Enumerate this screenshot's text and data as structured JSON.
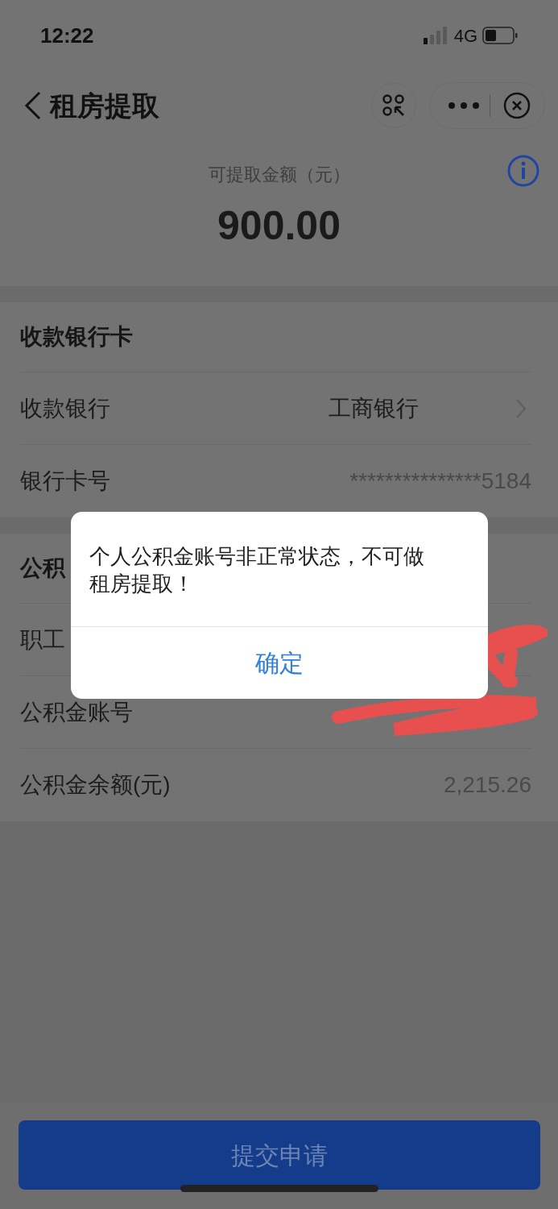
{
  "status_bar": {
    "time": "12:22",
    "network": "4G"
  },
  "nav": {
    "title": "租房提取"
  },
  "amount": {
    "label": "可提取金额（元）",
    "value": "900.00"
  },
  "sections": [
    {
      "title": "收款银行卡",
      "rows": [
        {
          "label": "收款银行",
          "value": "工商银行",
          "kind": "select"
        },
        {
          "label": "银行卡号",
          "value": "***************5184",
          "kind": "text"
        }
      ]
    },
    {
      "title": "公积",
      "rows": [
        {
          "label": "职工",
          "kind": "text"
        },
        {
          "label": "公积金账号",
          "kind": "text"
        },
        {
          "label": "公积金余额(元)",
          "value": "2,215.26",
          "kind": "text"
        }
      ]
    }
  ],
  "dialog": {
    "message": "个人公积金账号非正常状态，不可做租房提取！",
    "button": "确定"
  },
  "submit_button": "提交申请"
}
